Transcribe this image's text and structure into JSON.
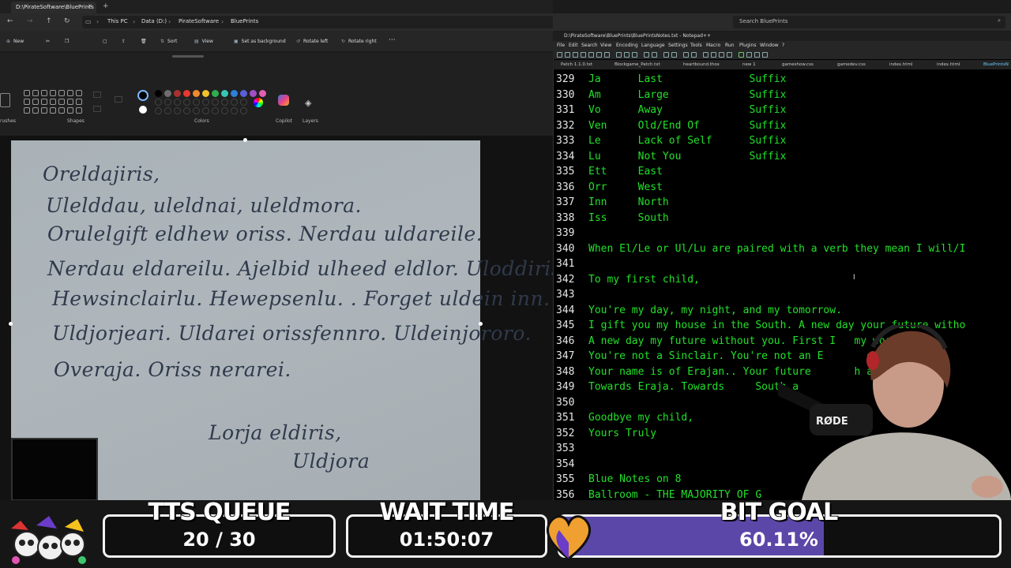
{
  "explorer": {
    "tab_title": "D:\\PirateSoftware\\BluePrints",
    "breadcrumb": [
      "This PC",
      "Data (D:)",
      "PirateSoftware",
      "BluePrints"
    ],
    "search_placeholder": "Search BluePrints",
    "commands": [
      "New",
      "Sort",
      "View",
      "Set as background",
      "Rotate left",
      "Rotate right"
    ]
  },
  "paint": {
    "groups": [
      "Shapes",
      "Colors",
      "Copilot",
      "Layers"
    ],
    "side_label": "rushes",
    "colors": [
      "#000000",
      "#6e6e6e",
      "#a8322e",
      "#e8382f",
      "#f08a2c",
      "#f4c12c",
      "#2fae4d",
      "#38c6b4",
      "#2f7fd8",
      "#5b5ed6",
      "#a24fc6",
      "#e25fb2"
    ],
    "letter_lines": [
      "Oreldajiris,",
      "Ulelddau, uleldnai, uleldmora.",
      "Orulelgift eldhew oriss. Nerdau uldareile.",
      "Nerdau eldareilu. Ajelbid ulheed eldlor. Uloddiris.",
      "Hewsinclairlu. Hewepsenlu. . Forget uldein inn.",
      "Uldjorjeari. Uldarei orissfennro. Uldeinjororo.",
      "Overaja. Oriss nerarei.",
      "Lorja eldiris,",
      "Uldjora"
    ]
  },
  "notepad": {
    "title": "D:\\PirateSoftware\\BluePrints\\BluePrintsNotes.txt - Notepad++",
    "menu": [
      "File",
      "Edit",
      "Search",
      "View",
      "Encoding",
      "Language",
      "Settings",
      "Tools",
      "Macro",
      "Run",
      "Plugins",
      "Window",
      "?"
    ],
    "tabs": [
      "Patch 1.1.0.txt",
      "Blockgame_Patch.txt",
      "heartbound.thox",
      "new 1",
      "gameshow.css",
      "gamedev.css",
      "index.html",
      "index.html",
      "BluePrintsN"
    ],
    "lines": [
      {
        "n": "329",
        "t": "Ja      Last              Suffix"
      },
      {
        "n": "330",
        "t": "Am      Large             Suffix"
      },
      {
        "n": "331",
        "t": "Vo      Away              Suffix"
      },
      {
        "n": "332",
        "t": "Ven     Old/End Of        Suffix"
      },
      {
        "n": "333",
        "t": "Le      Lack of Self      Suffix"
      },
      {
        "n": "334",
        "t": "Lu      Not You           Suffix"
      },
      {
        "n": "335",
        "t": "Ett     East"
      },
      {
        "n": "336",
        "t": "Orr     West"
      },
      {
        "n": "337",
        "t": "Inn     North"
      },
      {
        "n": "338",
        "t": "Iss     South"
      },
      {
        "n": "339",
        "t": ""
      },
      {
        "n": "340",
        "t": "When El/Le or Ul/Lu are paired with a verb they mean I will/I"
      },
      {
        "n": "341",
        "t": ""
      },
      {
        "n": "342",
        "t": "To my first child,"
      },
      {
        "n": "343",
        "t": ""
      },
      {
        "n": "344",
        "t": "You're my day, my night, and my tomorrow."
      },
      {
        "n": "345",
        "t": "I gift you my house in the South. A new day your future witho"
      },
      {
        "n": "346",
        "t": "A new day my future without you. First I   my words: U"
      },
      {
        "n": "347",
        "t": "You're not a Sinclair. You're not an E       et your pas"
      },
      {
        "n": "348",
        "t": "Your name is of Erajan.. Your future       h away fr"
      },
      {
        "n": "349",
        "t": "Towards Eraja. Towards     South a"
      },
      {
        "n": "350",
        "t": ""
      },
      {
        "n": "351",
        "t": "Goodbye my child,"
      },
      {
        "n": "352",
        "t": "Yours Truly"
      },
      {
        "n": "353",
        "t": ""
      },
      {
        "n": "354",
        "t": ""
      },
      {
        "n": "355",
        "t": "Blue Notes on 8"
      },
      {
        "n": "356",
        "t": "Ballroom - THE MAJORITY OF G"
      }
    ]
  },
  "cam": {
    "mic_label": "RØDE"
  },
  "overlay": {
    "tts_title": "TTS QUEUE",
    "tts_value": "20 / 30",
    "wait_title": "WAIT TIME",
    "wait_value": "01:50:07",
    "bit_title": "BIT GOAL",
    "bit_value": "60.11%",
    "bit_progress": 0.6011,
    "colors": {
      "bar": "#5b47a8",
      "heart": "#f0a030"
    }
  }
}
